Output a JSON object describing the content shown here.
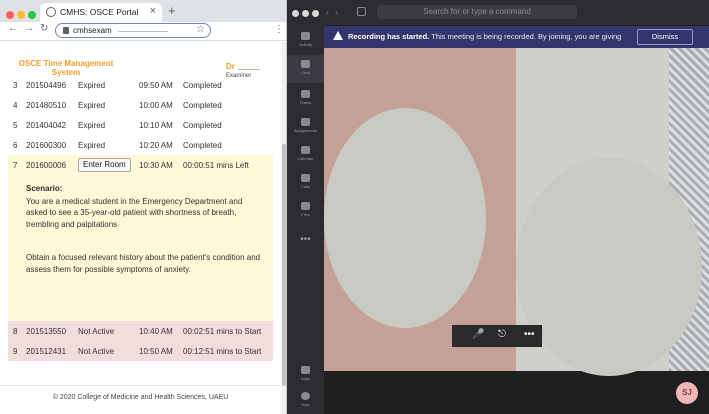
{
  "browser": {
    "tab_title": "CMHS: OSCE Portal",
    "url": "cmhsexam",
    "new_tab_symbol": "+",
    "close_tab_symbol": "×"
  },
  "portal": {
    "title": "OSCE Time Management System",
    "examiner_name": "Dr",
    "examiner_role": "Examiner",
    "rows": [
      {
        "num": "3",
        "id": "201504496",
        "status": "Expired",
        "time": "09:50 AM",
        "state": "Completed"
      },
      {
        "num": "4",
        "id": "201480510",
        "status": "Expired",
        "time": "10:00 AM",
        "state": "Completed"
      },
      {
        "num": "5",
        "id": "201404042",
        "status": "Expired",
        "time": "10:10 AM",
        "state": "Completed"
      },
      {
        "num": "6",
        "id": "201600300",
        "status": "Expired",
        "time": "10:20 AM",
        "state": "Completed"
      }
    ],
    "active_row": {
      "num": "7",
      "id": "201600006",
      "button": "Enter Room",
      "time": "10:30 AM",
      "state": "00:00:51 mins Left"
    },
    "scenario": {
      "label": "Scenario:",
      "text1": "You are a medical student in the Emergency Department and asked to see a 35-year-old patient with shortness of breath, trembling and palpitations",
      "text2": "Obtain a focused relevant history about the patient's condition and assess them for possible symptoms of anxiety."
    },
    "pending_rows": [
      {
        "num": "8",
        "id": "201513550",
        "status": "Not Active",
        "time": "10:40 AM",
        "state": "00:02:51 mins to Start"
      },
      {
        "num": "9",
        "id": "201512431",
        "status": "Not Active",
        "time": "10:50 AM",
        "state": "00:12:51 mins to Start"
      }
    ],
    "footer": "© 2020 College of Medicine and Health Sciences, UAEU"
  },
  "teams": {
    "search_placeholder": "Search for or type a command",
    "rail": [
      "Activity",
      "Chat",
      "Teams",
      "Assignments",
      "Calendar",
      "Calls",
      "Files",
      "Apps",
      "Help"
    ],
    "banner_bold": "Recording has started.",
    "banner_text": "This meeting is being recorded. By joining, you are giving co...",
    "dismiss_label": "Dismiss",
    "avatar_initials": "SJ"
  },
  "colors": {
    "portal_accent": "#f0a030",
    "active_row": "#fdf8d6",
    "pending_row": "#f3dcdc",
    "banner": "#35356e"
  }
}
